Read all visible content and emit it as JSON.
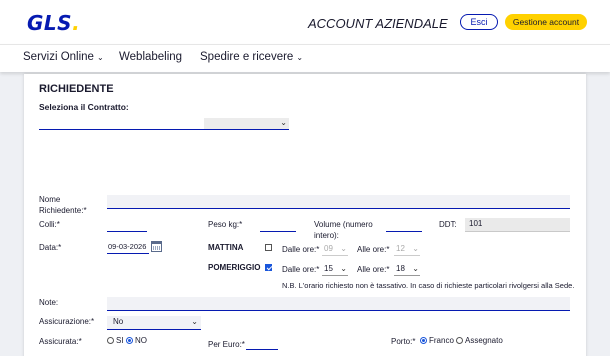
{
  "header": {
    "logo_text": "GLS",
    "logo_dot": ".",
    "title": "ACCOUNT AZIENDALE",
    "esci_label": "Esci",
    "gestione_label": "Gestione account"
  },
  "nav": {
    "items": [
      {
        "label": "Servizi Online",
        "chevron": "⌄"
      },
      {
        "label": "Weblabeling",
        "chevron": ""
      },
      {
        "label": "Spedire e ricevere",
        "chevron": "⌄"
      }
    ]
  },
  "form": {
    "section_title": "RICHIEDENTE",
    "contract_label": "Seleziona il Contratto:",
    "contract_value": "",
    "nome_label": "Nome Richiedente:*",
    "nome_value": "",
    "colli_label": "Colli:*",
    "colli_value": "",
    "peso_label": "Peso kg:*",
    "peso_value": "",
    "volume_label": "Volume (numero intero):",
    "volume_value": "",
    "ddt_label": "DDT:",
    "ddt_value": "101",
    "data_label": "Data:*",
    "data_value": "09-03-2026",
    "mattina_label": "MATTINA",
    "mattina_checked": false,
    "mattina_dalle_label": "Dalle ore:*",
    "mattina_dalle_value": "09",
    "mattina_alle_label": "Alle ore:*",
    "mattina_alle_value": "12",
    "pomeriggio_label": "POMERIGGIO",
    "pomeriggio_checked": true,
    "pomeriggio_dalle_label": "Dalle ore:*",
    "pomeriggio_dalle_value": "15",
    "pomeriggio_alle_label": "Alle ore:*",
    "pomeriggio_alle_value": "18",
    "note_text": "N.B. L'orario richiesto non è tassativo. In caso di richieste particolari rivolgersi alla Sede.",
    "note_label": "Note:",
    "note_value": "",
    "assicurazione_label": "Assicurazione:*",
    "assicurazione_value": "No",
    "assicurata_label": "Assicurata:*",
    "assicurata_options": [
      "SI",
      "NO"
    ],
    "assicurata_selected": "NO",
    "per_euro_label": "Per Euro:*",
    "per_euro_value": "",
    "porto_label": "Porto:*",
    "porto_options": [
      "Franco",
      "Assegnato"
    ],
    "porto_selected": "Franco"
  },
  "colors": {
    "brand_blue": "#061ab1",
    "brand_yellow": "#ffd100",
    "checkbox_blue": "#1a56db"
  },
  "icons": {
    "calendar": "calendar-icon",
    "chevron": "chevron-down-icon"
  }
}
